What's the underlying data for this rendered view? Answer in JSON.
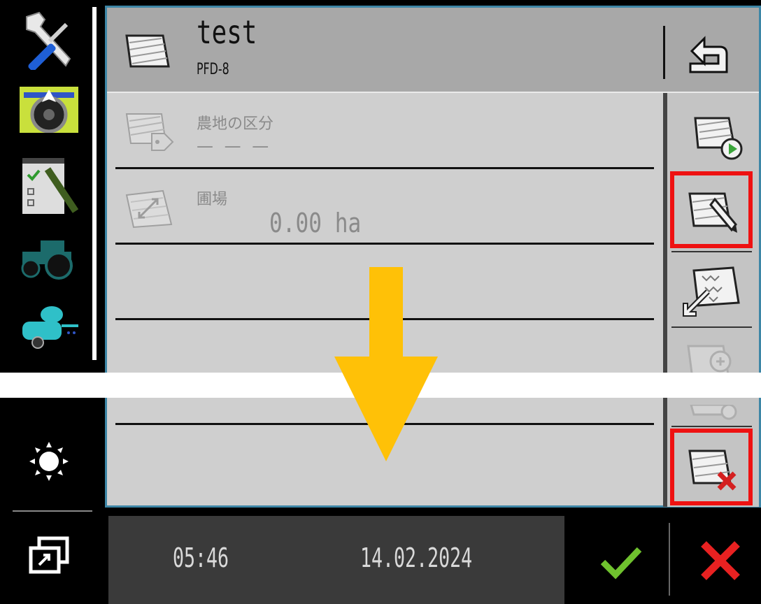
{
  "header": {
    "title": "test",
    "subtitle": "PFD-8",
    "icon": "field-icon",
    "back_icon": "back-arrow-icon"
  },
  "rows": [
    {
      "label": "農地の区分",
      "value": "— — —",
      "icon": "field-tag-icon"
    },
    {
      "label": "圃場",
      "value": "0.00 ha",
      "icon": "field-area-icon"
    }
  ],
  "toolbar": {
    "buttons": [
      {
        "name": "start-field-button",
        "icon": "field-play-icon",
        "highlighted": false
      },
      {
        "name": "edit-field-button",
        "icon": "field-edit-icon",
        "highlighted": true
      },
      {
        "name": "import-boundary-button",
        "icon": "boundary-import-icon",
        "highlighted": false
      },
      {
        "name": "zoom-field-button",
        "icon": "field-zoom-icon",
        "highlighted": false,
        "disabled": true
      },
      {
        "name": "field-settings-button",
        "icon": "field-gear-icon",
        "highlighted": false,
        "disabled": true
      },
      {
        "name": "delete-field-button",
        "icon": "field-delete-icon",
        "highlighted": true
      }
    ]
  },
  "left_rail": {
    "items": [
      "tools-icon",
      "guidance-steering-icon",
      "task-notepad-icon",
      "tractor-icon",
      "sprayer-icon"
    ],
    "brightness_icon": "brightness-icon",
    "window_icon": "window-switch-icon"
  },
  "footer": {
    "time": "05:46",
    "date": "14.02.2024",
    "confirm_icon": "check-icon",
    "cancel_icon": "cancel-x-icon"
  },
  "colors": {
    "panel_border": "#3d86a6",
    "highlight": "#ee1111",
    "arrow": "#ffc107",
    "confirm": "#6fc22e",
    "cancel": "#e82121"
  },
  "overlay_arrow_icon": "down-arrow-icon"
}
